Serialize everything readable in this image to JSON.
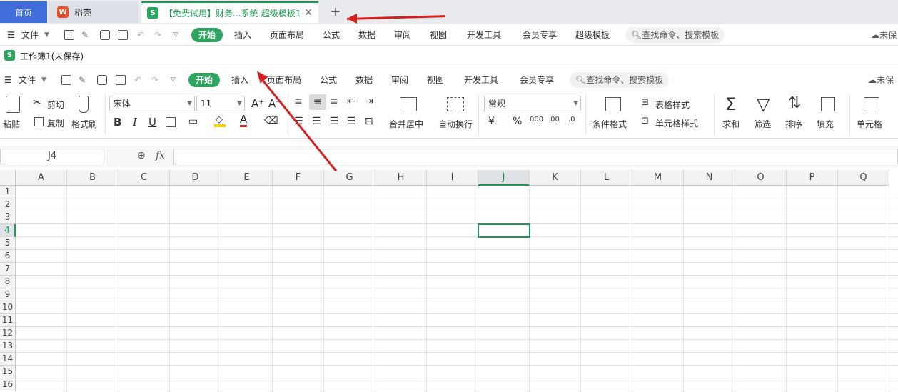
{
  "tabs": {
    "home": "首页",
    "daoke": "稻壳",
    "doc": "【免费试用】财务...系统-超级模板1",
    "doc_icon": "S",
    "daoke_icon": "W",
    "add": "+"
  },
  "outer_menu": {
    "file": "文件",
    "items": [
      "开始",
      "插入",
      "页面布局",
      "公式",
      "数据",
      "审阅",
      "视图",
      "开发工具",
      "会员专享",
      "超级模板"
    ],
    "search": "查找命令、搜索模板",
    "right": "未保"
  },
  "workbook_title": "工作簿1(未保存)",
  "inner_menu": {
    "file": "文件",
    "items": [
      "开始",
      "插入",
      "页面布局",
      "公式",
      "数据",
      "审阅",
      "视图",
      "开发工具",
      "会员专享"
    ],
    "search": "查找命令、搜索模板",
    "right": "未保"
  },
  "ribbon": {
    "paste": "粘贴",
    "cut": "剪切",
    "copy": "复制",
    "format_painter": "格式刷",
    "font": "宋体",
    "size": "11",
    "bold": "B",
    "italic": "I",
    "underline": "U",
    "merge": "合并居中",
    "wrap": "自动换行",
    "number_format": "常规",
    "currency": "¥",
    "percent": "%",
    "thousands": "000",
    "inc_decimal": ".00",
    "dec_decimal": ".0",
    "cond_format": "条件格式",
    "table_style": "表格样式",
    "cell_style": "单元格样式",
    "sum": "求和",
    "filter": "筛选",
    "sort": "排序",
    "fill": "填充",
    "cell": "单元格"
  },
  "formula_bar": {
    "name_box": "J4",
    "fx": "fx"
  },
  "grid": {
    "columns": [
      "A",
      "B",
      "C",
      "D",
      "E",
      "F",
      "G",
      "H",
      "I",
      "J",
      "K",
      "L",
      "M",
      "N",
      "O",
      "P",
      "Q"
    ],
    "rows": [
      "1",
      "2",
      "3",
      "4",
      "5",
      "6",
      "7",
      "8",
      "9",
      "10",
      "11",
      "12",
      "13",
      "14",
      "15",
      "16"
    ],
    "selected_cell": "J4"
  },
  "colors": {
    "accent_green": "#2ea55e",
    "tab_blue": "#3f6dd9",
    "arrow_red": "#d42020"
  }
}
